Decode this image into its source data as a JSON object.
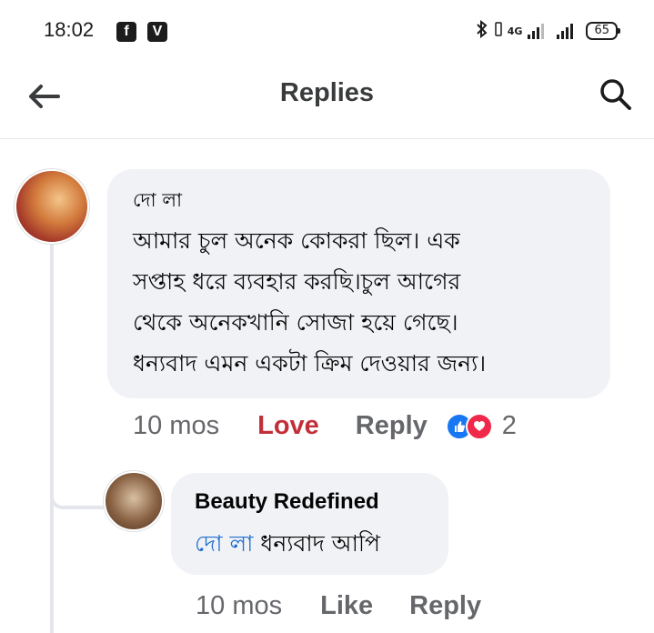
{
  "status_bar": {
    "time": "18:02",
    "app_icons": [
      "f",
      "V"
    ],
    "network_label": "4G",
    "battery": "65"
  },
  "header": {
    "title": "Replies",
    "back_icon": "arrow-left-icon",
    "search_icon": "search-icon"
  },
  "comment": {
    "author": "দো লা",
    "lines": [
      "আমার চুল অনেক কোকরা ছিল। এক",
      "সপ্তাহ ধরে ব্যবহার করছি।চুল আগের",
      "থেকে অনেকখানি সোজা হয়ে গেছে।",
      "ধন্যবাদ এমন একটা ক্রিম দেওয়ার জন্য।"
    ],
    "time_ago": "10 mos",
    "reaction_label": "Love",
    "reply_label": "Reply",
    "reaction_count": "2",
    "reaction_icons": [
      "like-icon",
      "love-icon"
    ]
  },
  "reply": {
    "author": "Beauty Redefined",
    "mention": "দো লা",
    "text": " ধন্যবাদ আপি",
    "time_ago": "10 mos",
    "like_label": "Like",
    "reply_label": "Reply"
  },
  "colors": {
    "accent_blue": "#1877f2",
    "love_red": "#c13039",
    "bubble_bg": "#f0f2f5",
    "meta_gray": "#65676b"
  }
}
